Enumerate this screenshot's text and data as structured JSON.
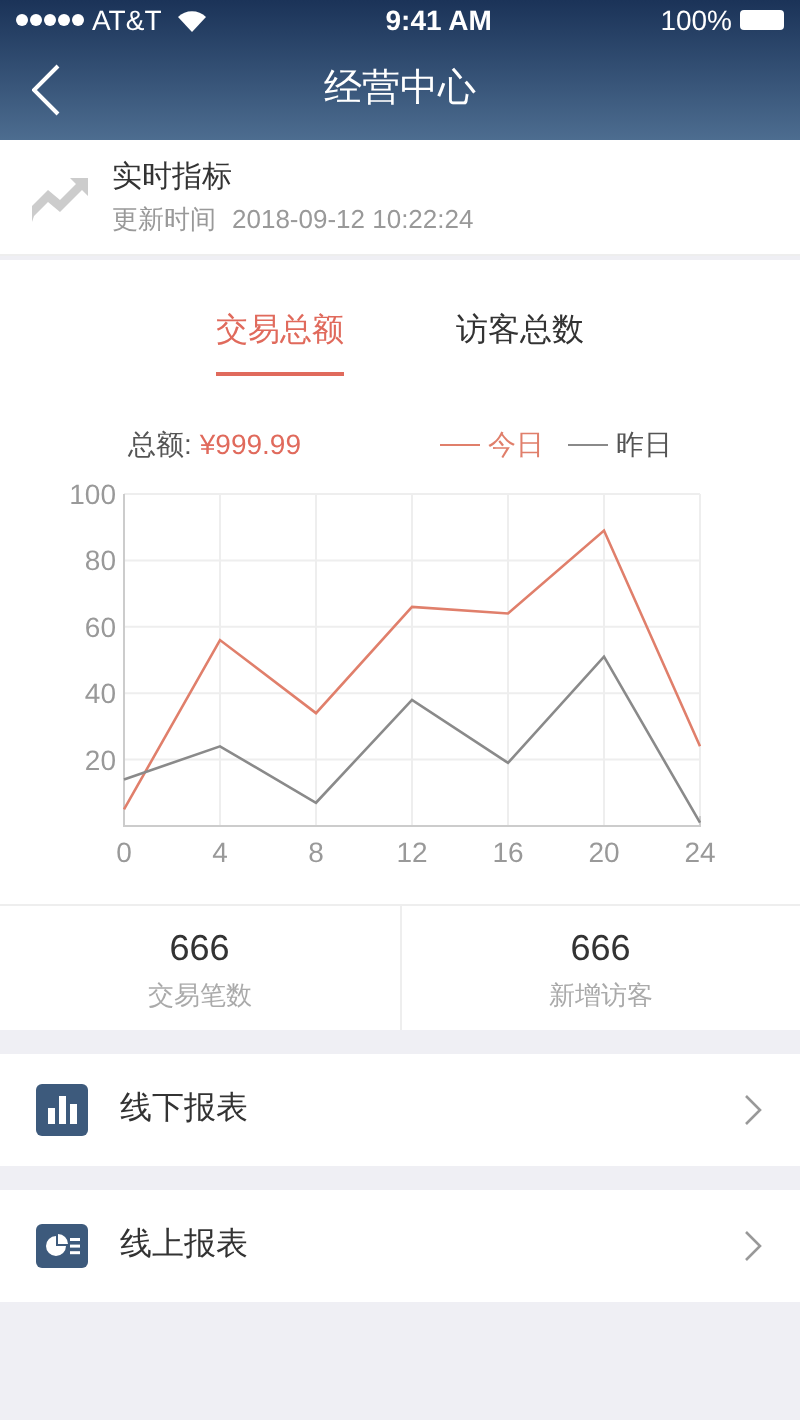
{
  "status_bar": {
    "carrier": "AT&T",
    "time": "9:41 AM",
    "battery": "100%"
  },
  "nav": {
    "title": "经营中心"
  },
  "realtime": {
    "title": "实时指标",
    "updated_label": "更新时间",
    "updated_time": "2018-09-12 10:22:24"
  },
  "tabs": [
    {
      "label": "交易总额",
      "selected": true
    },
    {
      "label": "访客总数",
      "selected": false
    }
  ],
  "summary": {
    "label": "总额:",
    "value": "¥999.99"
  },
  "chart_data": {
    "type": "line",
    "grid": true,
    "x": [
      0,
      4,
      8,
      12,
      16,
      20,
      24
    ],
    "xlim": [
      0,
      24
    ],
    "ylim": [
      0,
      100
    ],
    "xticks": [
      0,
      4,
      8,
      12,
      16,
      20,
      24
    ],
    "yticks": [
      20,
      40,
      60,
      80,
      100
    ],
    "series": [
      {
        "name": "今日",
        "color": "#e07f6b",
        "values": [
          5,
          56,
          34,
          66,
          64,
          89,
          24
        ]
      },
      {
        "name": "昨日",
        "color": "#8a8a8a",
        "values": [
          14,
          24,
          7,
          38,
          19,
          51,
          1
        ]
      }
    ]
  },
  "stats": [
    {
      "value": "666",
      "label": "交易笔数"
    },
    {
      "value": "666",
      "label": "新增访客"
    }
  ],
  "menu": [
    {
      "kind": "bars",
      "label": "线下报表"
    },
    {
      "kind": "pie",
      "label": "线上报表"
    }
  ]
}
